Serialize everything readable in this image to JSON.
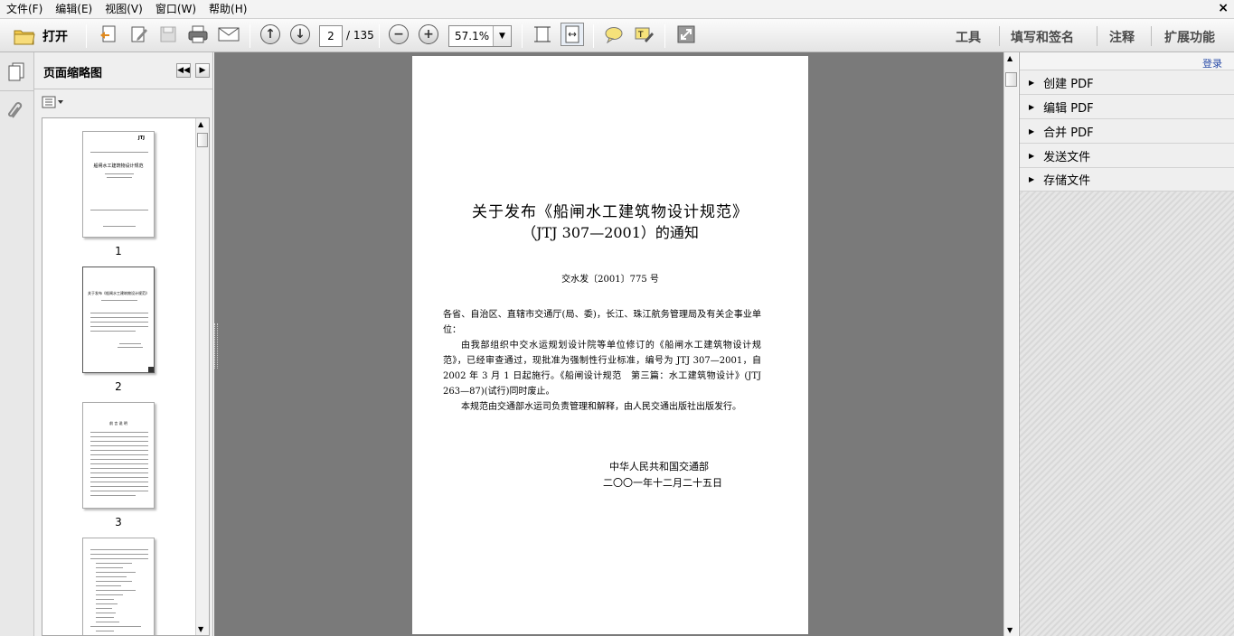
{
  "menu": [
    "文件(F)",
    "编辑(E)",
    "视图(V)",
    "窗口(W)",
    "帮助(H)"
  ],
  "close_label": "×",
  "toolbar": {
    "open_label": "打开",
    "page_current": "2",
    "page_total": "/ 135",
    "zoom": "57.1%",
    "right_links": [
      "工具",
      "填写和签名",
      "注释",
      "扩展功能"
    ]
  },
  "thumb_panel": {
    "title": "页面缩略图",
    "thumbs": [
      {
        "label": "1",
        "header": "JTJ",
        "title": "船闸水工建筑物设计规范"
      },
      {
        "label": "2",
        "header": "",
        "title": "关于发布《船闸水工建筑物设计规范》"
      },
      {
        "label": "3",
        "header": "",
        "title": "前 言 说 明"
      },
      {
        "label": "",
        "header": "",
        "title": ""
      }
    ]
  },
  "document": {
    "title_line1": "关于发布《船闸水工建筑物设计规范》",
    "title_line2": "（JTJ 307—2001）的通知",
    "doc_number": "交水发〔2001〕775 号",
    "para1": "各省、自治区、直辖市交通厅(局、委)，长江、珠江航务管理局及有关企事业单位：",
    "para2": "由我部组织中交水运规划设计院等单位修订的《船闸水工建筑物设计规范》，已经审查通过，现批准为强制性行业标准，编号为 JTJ 307—2001，自 2002 年 3 月 1 日起施行。《船闸设计规范　第三篇：水工建筑物设计》(JTJ 263—87)(试行)同时废止。",
    "para3": "本规范由交通部水运司负责管理和解释，由人民交通出版社出版发行。",
    "sign_org": "中华人民共和国交通部",
    "sign_date": "二〇〇一年十二月二十五日"
  },
  "right_pane": {
    "login": "登录",
    "items": [
      "创建 PDF",
      "编辑 PDF",
      "合并 PDF",
      "发送文件",
      "存储文件"
    ]
  }
}
